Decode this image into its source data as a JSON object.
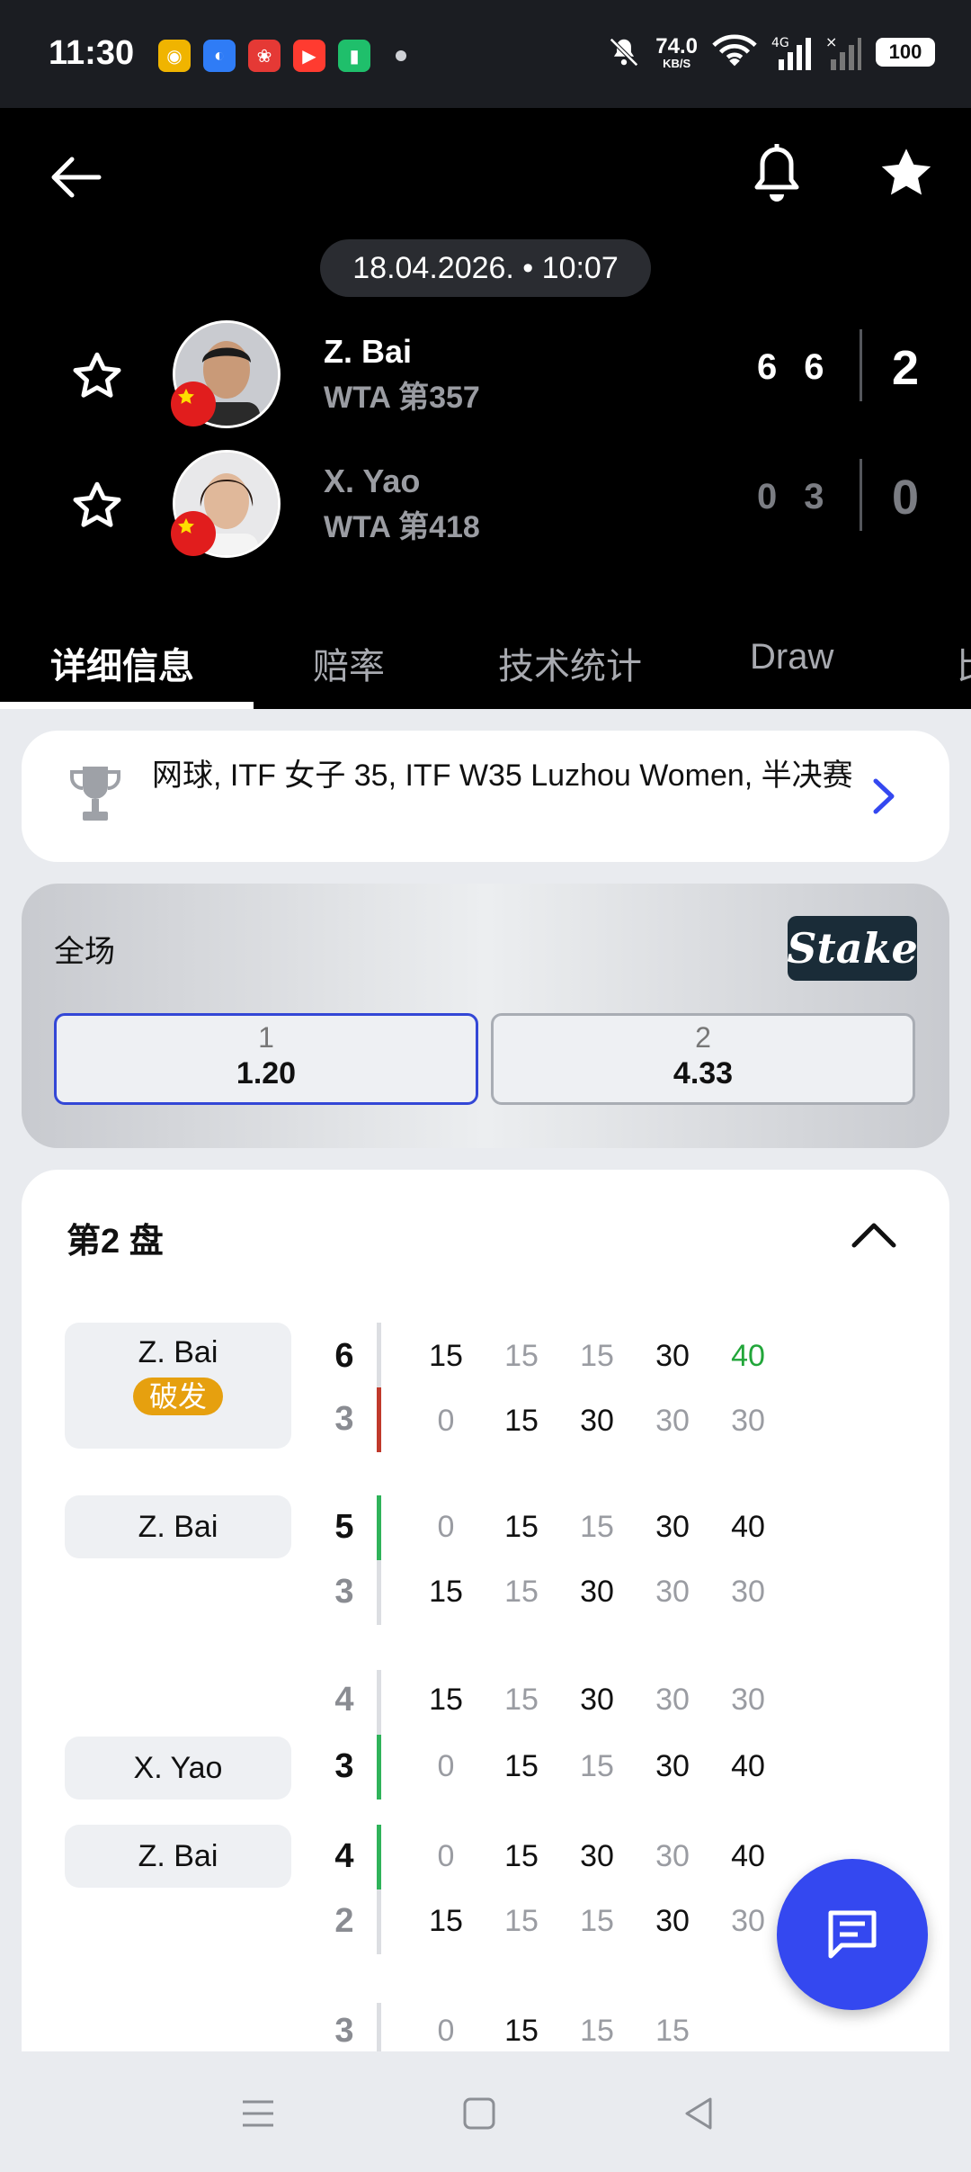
{
  "status_bar": {
    "time": "11:30",
    "net_speed_value": "74.0",
    "net_speed_unit": "KB/S",
    "network_type": "4G",
    "battery": "100"
  },
  "match": {
    "datetime": "18.04.2026. • 10:07",
    "players": [
      {
        "name": "Z. Bai",
        "rank": "WTA 第357",
        "sets": [
          "6",
          "6"
        ],
        "total": "2"
      },
      {
        "name": "X. Yao",
        "rank": "WTA 第418",
        "sets": [
          "0",
          "3"
        ],
        "total": "0"
      }
    ]
  },
  "tabs": [
    "详细信息",
    "赔率",
    "技术统计",
    "Draw",
    "比"
  ],
  "tournament": {
    "text": "网球, ITF 女子 35, ITF W35 Luzhou Women, 半决赛"
  },
  "odds": {
    "label": "全场",
    "provider": "Stake",
    "options": [
      {
        "label": "1",
        "value": "1.20"
      },
      {
        "label": "2",
        "value": "4.33"
      }
    ]
  },
  "set_detail": {
    "title": "第2 盘",
    "break_label": "破发",
    "games": [
      {
        "server": "Z. Bai",
        "break": true,
        "score_top": "6",
        "score_bottom": "3",
        "points_top": [
          "15",
          "15",
          "15",
          "30",
          "40"
        ],
        "points_bottom": [
          "0",
          "15",
          "30",
          "30",
          "30"
        ]
      },
      {
        "server": "Z. Bai",
        "break": false,
        "score_top": "5",
        "score_bottom": "3",
        "points_top": [
          "0",
          "15",
          "15",
          "30",
          "40"
        ],
        "points_bottom": [
          "15",
          "15",
          "30",
          "30",
          "30"
        ]
      },
      {
        "server": "X. Yao",
        "break": false,
        "score_top": "4",
        "score_bottom": "3",
        "points_top": [
          "15",
          "15",
          "30",
          "30",
          "30"
        ],
        "points_bottom": [
          "0",
          "15",
          "15",
          "30",
          "40"
        ]
      },
      {
        "server": "Z. Bai",
        "break": false,
        "score_top": "4",
        "score_bottom": "2",
        "points_top": [
          "0",
          "15",
          "30",
          "30",
          "40"
        ],
        "points_bottom": [
          "15",
          "15",
          "15",
          "30",
          "30"
        ]
      },
      {
        "server": "",
        "break": false,
        "score_top": "3",
        "score_bottom": "",
        "points_top": [
          "0",
          "15",
          "15",
          "15"
        ],
        "points_bottom": []
      }
    ]
  },
  "colors": {
    "accent": "#3448f0",
    "win_point": "#22a63a",
    "break_badge": "#e6a00f",
    "break_bar": "#c0392b",
    "hold_bar": "#2fb35a"
  }
}
